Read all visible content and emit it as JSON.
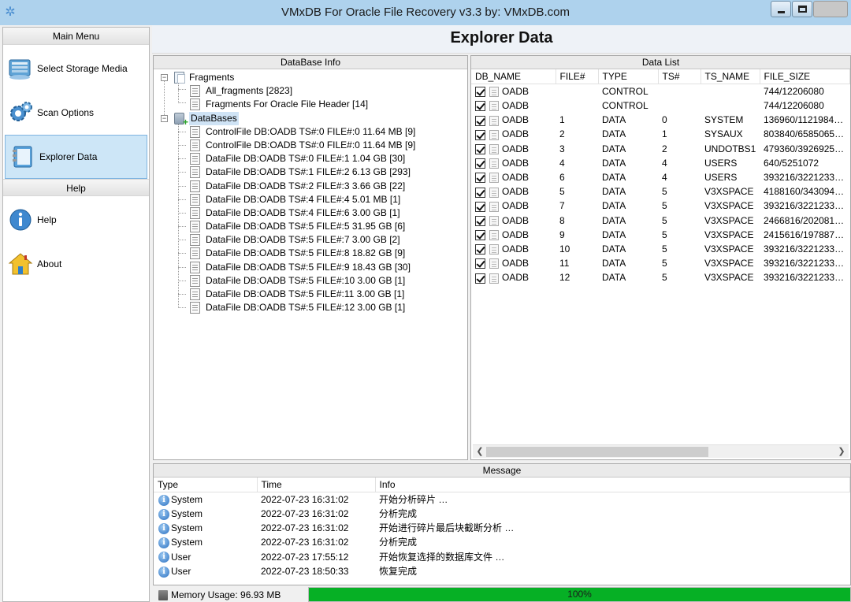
{
  "window": {
    "title": "VMxDB For Oracle File Recovery v3.3 by: VMxDB.com"
  },
  "sidebar": {
    "main_menu_label": "Main Menu",
    "help_label": "Help",
    "main_items": [
      {
        "label": "Select Storage Media",
        "icon": "storage-media-icon"
      },
      {
        "label": "Scan Options",
        "icon": "gear-icon"
      },
      {
        "label": "Explorer Data",
        "icon": "notebook-icon",
        "selected": true
      }
    ],
    "help_items": [
      {
        "label": "Help",
        "icon": "info-icon"
      },
      {
        "label": "About",
        "icon": "home-icon"
      }
    ]
  },
  "header": {
    "title": "Explorer Data"
  },
  "db_info": {
    "title": "DataBase Info",
    "fragments": {
      "label": "Fragments",
      "children": [
        "All_fragments [2823]",
        "Fragments For Oracle File Header [14]"
      ]
    },
    "databases": {
      "label": "DataBases",
      "children": [
        "ControlFile DB:OADB TS#:0 FILE#:0 11.64 MB [9]",
        "ControlFile DB:OADB TS#:0 FILE#:0 11.64 MB [9]",
        "DataFile DB:OADB TS#:0 FILE#:1 1.04 GB [30]",
        "DataFile DB:OADB TS#:1 FILE#:2 6.13 GB [293]",
        "DataFile DB:OADB TS#:2 FILE#:3 3.66 GB [22]",
        "DataFile DB:OADB TS#:4 FILE#:4 5.01 MB [1]",
        "DataFile DB:OADB TS#:4 FILE#:6 3.00 GB [1]",
        "DataFile DB:OADB TS#:5 FILE#:5 31.95 GB [6]",
        "DataFile DB:OADB TS#:5 FILE#:7 3.00 GB [2]",
        "DataFile DB:OADB TS#:5 FILE#:8 18.82 GB [9]",
        "DataFile DB:OADB TS#:5 FILE#:9 18.43 GB [30]",
        "DataFile DB:OADB TS#:5 FILE#:10 3.00 GB [1]",
        "DataFile DB:OADB TS#:5 FILE#:11 3.00 GB [1]",
        "DataFile DB:OADB TS#:5 FILE#:12 3.00 GB [1]"
      ]
    }
  },
  "data_list": {
    "title": "Data List",
    "columns": [
      "DB_NAME",
      "FILE#",
      "TYPE",
      "TS#",
      "TS_NAME",
      "FILE_SIZE"
    ],
    "rows": [
      {
        "checked": true,
        "db": "OADB",
        "file": "",
        "type": "CONTROL",
        "ts": "",
        "ts_name": "",
        "size": "744/12206080"
      },
      {
        "checked": true,
        "db": "OADB",
        "file": "",
        "type": "CONTROL",
        "ts": "",
        "ts_name": "",
        "size": "744/12206080"
      },
      {
        "checked": true,
        "db": "OADB",
        "file": "1",
        "type": "DATA",
        "ts": "0",
        "ts_name": "SYSTEM",
        "size": "136960/1121984…"
      },
      {
        "checked": true,
        "db": "OADB",
        "file": "2",
        "type": "DATA",
        "ts": "1",
        "ts_name": "SYSAUX",
        "size": "803840/6585065…"
      },
      {
        "checked": true,
        "db": "OADB",
        "file": "3",
        "type": "DATA",
        "ts": "2",
        "ts_name": "UNDOTBS1",
        "size": "479360/3926925…"
      },
      {
        "checked": true,
        "db": "OADB",
        "file": "4",
        "type": "DATA",
        "ts": "4",
        "ts_name": "USERS",
        "size": "640/5251072"
      },
      {
        "checked": true,
        "db": "OADB",
        "file": "6",
        "type": "DATA",
        "ts": "4",
        "ts_name": "USERS",
        "size": "393216/3221233…"
      },
      {
        "checked": true,
        "db": "OADB",
        "file": "5",
        "type": "DATA",
        "ts": "5",
        "ts_name": "V3XSPACE",
        "size": "4188160/343094…"
      },
      {
        "checked": true,
        "db": "OADB",
        "file": "7",
        "type": "DATA",
        "ts": "5",
        "ts_name": "V3XSPACE",
        "size": "393216/3221233…"
      },
      {
        "checked": true,
        "db": "OADB",
        "file": "8",
        "type": "DATA",
        "ts": "5",
        "ts_name": "V3XSPACE",
        "size": "2466816/202081…"
      },
      {
        "checked": true,
        "db": "OADB",
        "file": "9",
        "type": "DATA",
        "ts": "5",
        "ts_name": "V3XSPACE",
        "size": "2415616/197887…"
      },
      {
        "checked": true,
        "db": "OADB",
        "file": "10",
        "type": "DATA",
        "ts": "5",
        "ts_name": "V3XSPACE",
        "size": "393216/3221233…"
      },
      {
        "checked": true,
        "db": "OADB",
        "file": "11",
        "type": "DATA",
        "ts": "5",
        "ts_name": "V3XSPACE",
        "size": "393216/3221233…"
      },
      {
        "checked": true,
        "db": "OADB",
        "file": "12",
        "type": "DATA",
        "ts": "5",
        "ts_name": "V3XSPACE",
        "size": "393216/3221233…"
      }
    ]
  },
  "message": {
    "title": "Message",
    "columns": [
      "Type",
      "Time",
      "Info"
    ],
    "rows": [
      {
        "type": "System",
        "time": "2022-07-23 16:31:02",
        "info": "开始分析碎片 …"
      },
      {
        "type": "System",
        "time": "2022-07-23 16:31:02",
        "info": "分析完成"
      },
      {
        "type": "System",
        "time": "2022-07-23 16:31:02",
        "info": "开始进行碎片最后块截断分析 …"
      },
      {
        "type": "System",
        "time": "2022-07-23 16:31:02",
        "info": "分析完成"
      },
      {
        "type": "User",
        "time": "2022-07-23 17:55:12",
        "info": "开始恢复选择的数据库文件 …"
      },
      {
        "type": "User",
        "time": "2022-07-23 18:50:33",
        "info": "恢复完成"
      }
    ]
  },
  "status": {
    "memory": "Memory Usage: 96.93 MB",
    "progress_text": "100%",
    "progress_value": 1.0,
    "progress_color": "#06b025"
  }
}
